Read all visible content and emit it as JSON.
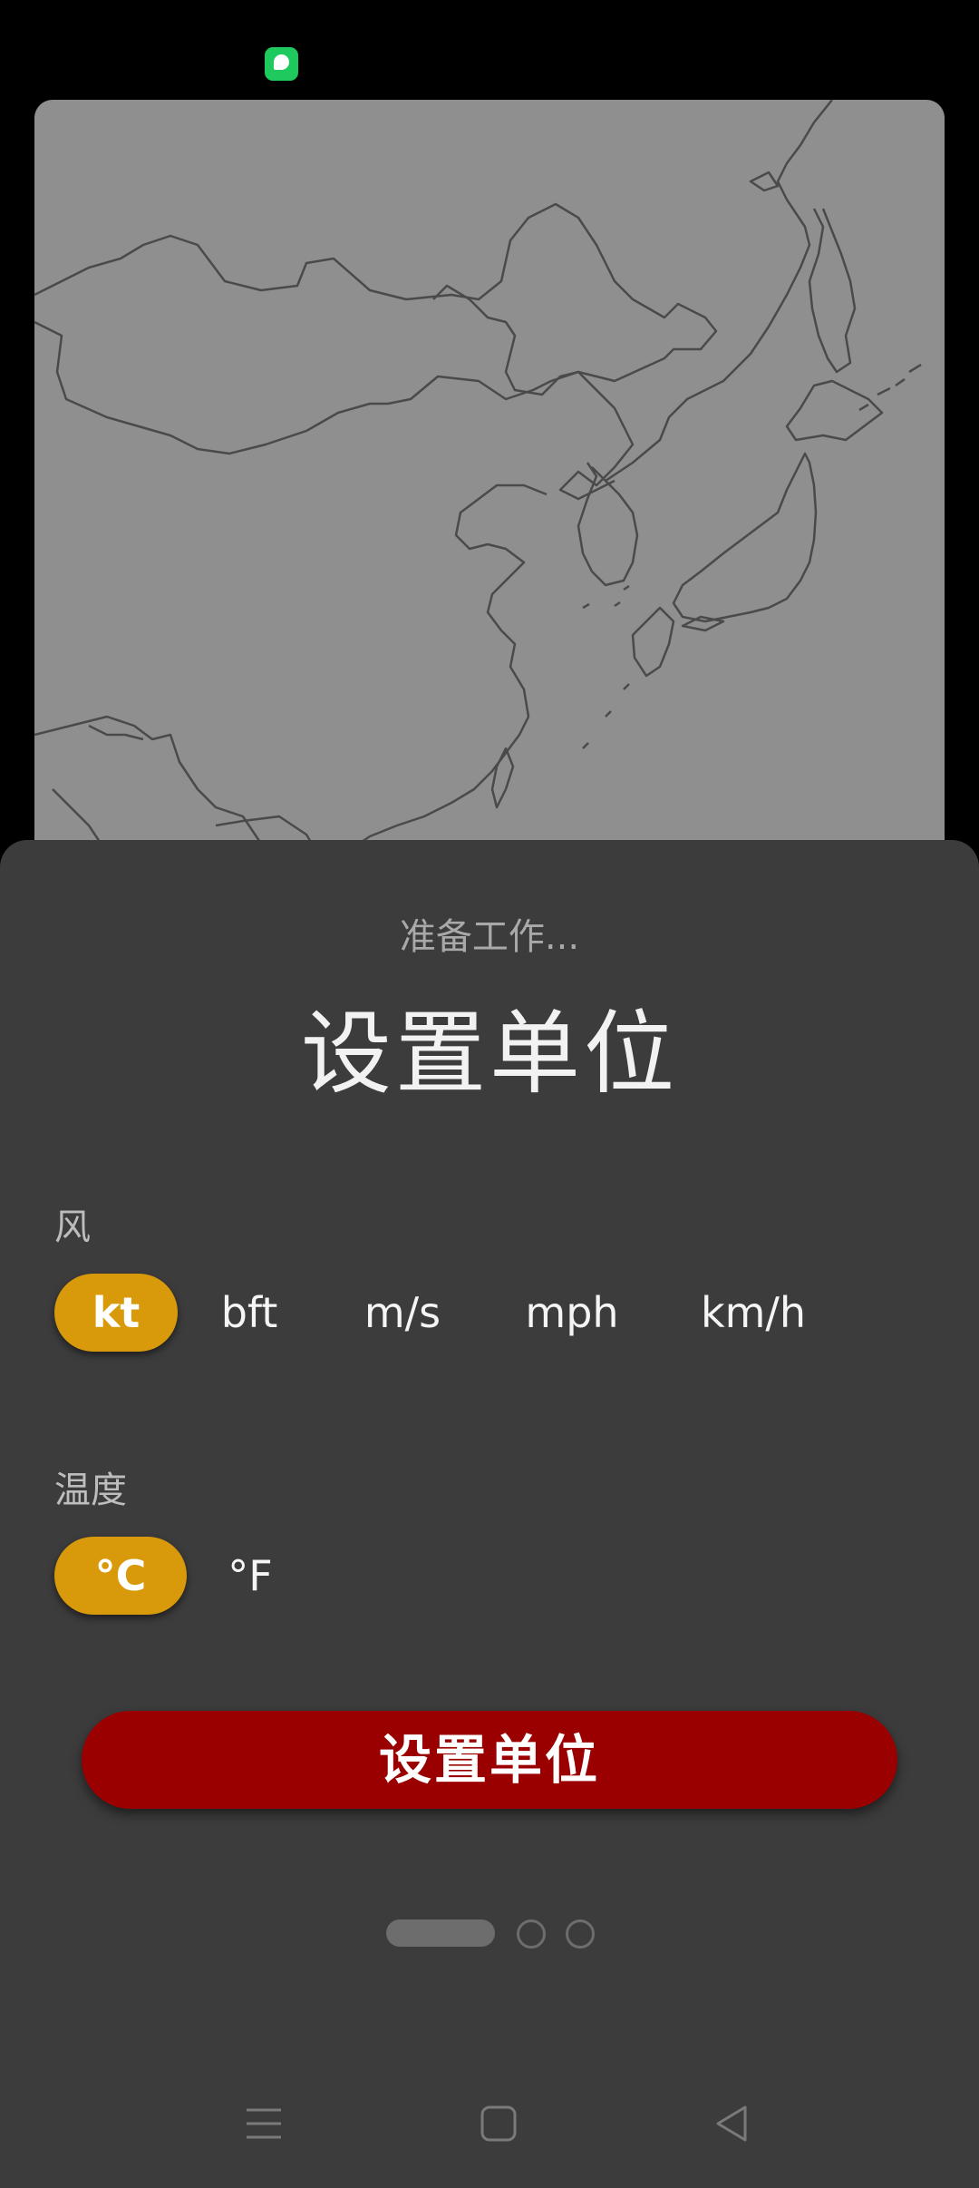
{
  "header": {
    "subtitle": "准备工作...",
    "title": "设置单位"
  },
  "wind": {
    "label": "风",
    "options": [
      "kt",
      "bft",
      "m/s",
      "mph",
      "km/h"
    ],
    "selected": "kt"
  },
  "temperature": {
    "label": "温度",
    "options": [
      "°C",
      "°F"
    ],
    "selected": "°C"
  },
  "action": {
    "label": "设置单位"
  },
  "pager": {
    "pages": 3,
    "current": 1
  },
  "colors": {
    "accent": "#d89a0b",
    "primary_button": "#9a0000",
    "sheet_background": "#3c3c3c",
    "map_background": "#8f8f8f"
  }
}
